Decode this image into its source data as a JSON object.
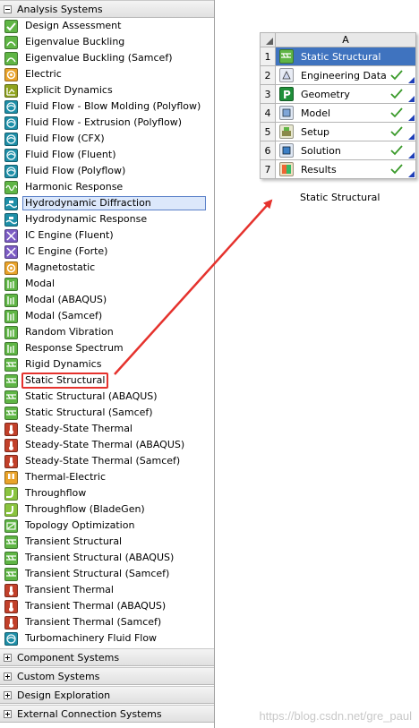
{
  "toolbox": {
    "analysis_systems_label": "Analysis Systems",
    "items": [
      {
        "label": "Design Assessment",
        "icon": "design-assessment-icon",
        "color": "green"
      },
      {
        "label": "Eigenvalue Buckling",
        "icon": "eigenvalue-buckling-icon",
        "color": "green"
      },
      {
        "label": "Eigenvalue Buckling (Samcef)",
        "icon": "eigenvalue-buckling-icon",
        "color": "green"
      },
      {
        "label": "Electric",
        "icon": "electric-icon",
        "color": "orange"
      },
      {
        "label": "Explicit Dynamics",
        "icon": "explicit-dynamics-icon",
        "color": "olive"
      },
      {
        "label": "Fluid Flow - Blow Molding (Polyflow)",
        "icon": "fluid-flow-icon",
        "color": "teal"
      },
      {
        "label": "Fluid Flow - Extrusion (Polyflow)",
        "icon": "fluid-flow-icon",
        "color": "teal"
      },
      {
        "label": "Fluid Flow (CFX)",
        "icon": "fluid-flow-icon",
        "color": "teal"
      },
      {
        "label": "Fluid Flow (Fluent)",
        "icon": "fluid-flow-icon",
        "color": "teal"
      },
      {
        "label": "Fluid Flow (Polyflow)",
        "icon": "fluid-flow-icon",
        "color": "teal"
      },
      {
        "label": "Harmonic Response",
        "icon": "harmonic-response-icon",
        "color": "green"
      },
      {
        "label": "Hydrodynamic Diffraction",
        "icon": "hydrodynamic-icon",
        "color": "teal"
      },
      {
        "label": "Hydrodynamic Response",
        "icon": "hydrodynamic-icon",
        "color": "teal"
      },
      {
        "label": "IC Engine (Fluent)",
        "icon": "ic-engine-icon",
        "color": "purple"
      },
      {
        "label": "IC Engine (Forte)",
        "icon": "ic-engine-icon",
        "color": "purple"
      },
      {
        "label": "Magnetostatic",
        "icon": "magnetostatic-icon",
        "color": "orange"
      },
      {
        "label": "Modal",
        "icon": "modal-icon",
        "color": "green"
      },
      {
        "label": "Modal (ABAQUS)",
        "icon": "modal-icon",
        "color": "green"
      },
      {
        "label": "Modal (Samcef)",
        "icon": "modal-icon",
        "color": "green"
      },
      {
        "label": "Random Vibration",
        "icon": "random-vibration-icon",
        "color": "green"
      },
      {
        "label": "Response Spectrum",
        "icon": "response-spectrum-icon",
        "color": "green"
      },
      {
        "label": "Rigid Dynamics",
        "icon": "rigid-dynamics-icon",
        "color": "green"
      },
      {
        "label": "Static Structural",
        "icon": "static-structural-icon",
        "color": "green"
      },
      {
        "label": "Static Structural (ABAQUS)",
        "icon": "static-structural-icon",
        "color": "green"
      },
      {
        "label": "Static Structural (Samcef)",
        "icon": "static-structural-icon",
        "color": "green"
      },
      {
        "label": "Steady-State Thermal",
        "icon": "thermal-icon",
        "color": "red"
      },
      {
        "label": "Steady-State Thermal (ABAQUS)",
        "icon": "thermal-icon",
        "color": "red"
      },
      {
        "label": "Steady-State Thermal (Samcef)",
        "icon": "thermal-icon",
        "color": "red"
      },
      {
        "label": "Thermal-Electric",
        "icon": "thermal-electric-icon",
        "color": "orange"
      },
      {
        "label": "Throughflow",
        "icon": "throughflow-icon",
        "color": "lime"
      },
      {
        "label": "Throughflow (BladeGen)",
        "icon": "throughflow-icon",
        "color": "lime"
      },
      {
        "label": "Topology Optimization",
        "icon": "topology-optimization-icon",
        "color": "green"
      },
      {
        "label": "Transient Structural",
        "icon": "transient-structural-icon",
        "color": "green"
      },
      {
        "label": "Transient Structural (ABAQUS)",
        "icon": "transient-structural-icon",
        "color": "green"
      },
      {
        "label": "Transient Structural (Samcef)",
        "icon": "transient-structural-icon",
        "color": "green"
      },
      {
        "label": "Transient Thermal",
        "icon": "transient-thermal-icon",
        "color": "red"
      },
      {
        "label": "Transient Thermal (ABAQUS)",
        "icon": "transient-thermal-icon",
        "color": "red"
      },
      {
        "label": "Transient Thermal (Samcef)",
        "icon": "transient-thermal-icon",
        "color": "red"
      },
      {
        "label": "Turbomachinery Fluid Flow",
        "icon": "turbomachinery-icon",
        "color": "teal"
      }
    ],
    "selected_item": "Hydrodynamic Diffraction",
    "highlighted_item": "Static Structural",
    "categories": [
      {
        "label": "Component Systems"
      },
      {
        "label": "Custom Systems"
      },
      {
        "label": "Design Exploration"
      },
      {
        "label": "External Connection Systems"
      }
    ]
  },
  "schematic": {
    "column_header": "A",
    "rows": [
      {
        "num": "1",
        "label": "Static Structural",
        "icon": "static-structural-icon",
        "status": ""
      },
      {
        "num": "2",
        "label": "Engineering Data",
        "icon": "engineering-data-icon",
        "status": "check"
      },
      {
        "num": "3",
        "label": "Geometry",
        "icon": "geometry-icon",
        "status": "check"
      },
      {
        "num": "4",
        "label": "Model",
        "icon": "model-icon",
        "status": "check"
      },
      {
        "num": "5",
        "label": "Setup",
        "icon": "setup-icon",
        "status": "check"
      },
      {
        "num": "6",
        "label": "Solution",
        "icon": "solution-icon",
        "status": "check"
      },
      {
        "num": "7",
        "label": "Results",
        "icon": "results-icon",
        "status": "check"
      }
    ],
    "caption": "Static Structural"
  },
  "watermark": "https://blog.csdn.net/gre_paul",
  "colors": {
    "title_row_bg": "#3f73bf",
    "check_green": "#3a9a2a",
    "highlight_red": "#e5322d",
    "selected_bg": "#dce8fb"
  }
}
